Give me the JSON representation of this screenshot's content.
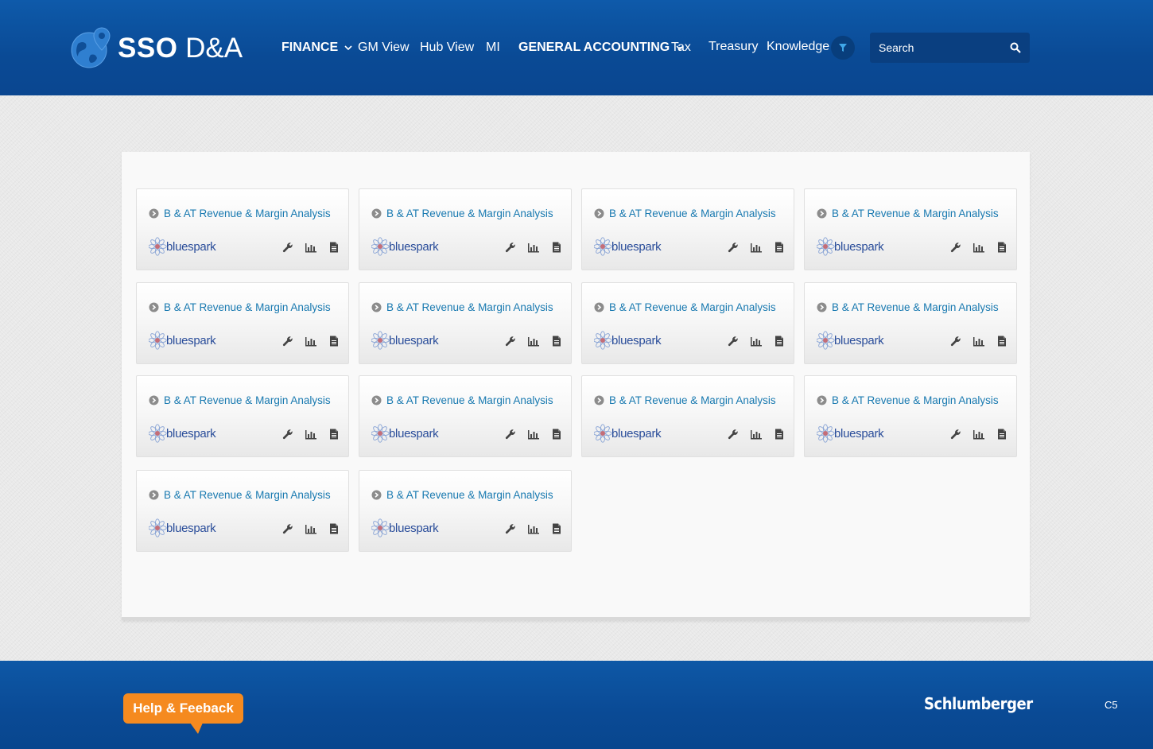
{
  "header": {
    "logo_bold": "SSO",
    "logo_light": "D&A",
    "nav": [
      {
        "label": "FINANCE",
        "bold": true,
        "dropdown": true
      },
      {
        "label": "GM View",
        "bold": false,
        "dropdown": false
      },
      {
        "label": "Hub View",
        "bold": false,
        "dropdown": false
      },
      {
        "label": "MI",
        "bold": false,
        "dropdown": false
      },
      {
        "label": "GENERAL ACCOUNTING",
        "bold": true,
        "dropdown": true
      },
      {
        "label": "Tax",
        "bold": false,
        "dropdown": false
      },
      {
        "label": "Treasury",
        "bold": false,
        "dropdown": false
      },
      {
        "label": "Knowledge",
        "bold": false,
        "dropdown": false
      }
    ],
    "filter_icon": "filter-icon",
    "search": {
      "placeholder": "Search",
      "icon": "search-icon"
    }
  },
  "cards": [
    {
      "title": "B & AT Revenue & Margin Analysis",
      "brand": "bluespark"
    },
    {
      "title": "B & AT Revenue & Margin Analysis",
      "brand": "bluespark"
    },
    {
      "title": "B & AT Revenue & Margin Analysis",
      "brand": "bluespark"
    },
    {
      "title": "B & AT Revenue & Margin Analysis",
      "brand": "bluespark"
    },
    {
      "title": "B & AT Revenue & Margin Analysis",
      "brand": "bluespark"
    },
    {
      "title": "B & AT Revenue & Margin Analysis",
      "brand": "bluespark"
    },
    {
      "title": "B & AT Revenue & Margin Analysis",
      "brand": "bluespark"
    },
    {
      "title": "B & AT Revenue & Margin Analysis",
      "brand": "bluespark"
    },
    {
      "title": "B & AT Revenue & Margin Analysis",
      "brand": "bluespark"
    },
    {
      "title": "B & AT Revenue & Margin Analysis",
      "brand": "bluespark"
    },
    {
      "title": "B & AT Revenue & Margin Analysis",
      "brand": "bluespark"
    },
    {
      "title": "B & AT Revenue & Margin Analysis",
      "brand": "bluespark"
    },
    {
      "title": "B & AT Revenue & Margin Analysis",
      "brand": "bluespark"
    },
    {
      "title": "B & AT Revenue & Margin Analysis",
      "brand": "bluespark"
    }
  ],
  "card_actions": [
    "wrench-icon",
    "bar-chart-icon",
    "document-icon"
  ],
  "footer": {
    "help_label": "Help & Feeback",
    "company": "Schlumberger",
    "code": "C5"
  },
  "colors": {
    "header_blue": "#0a4a95",
    "link_blue": "#1879b0",
    "help_orange": "#f58a1f"
  }
}
